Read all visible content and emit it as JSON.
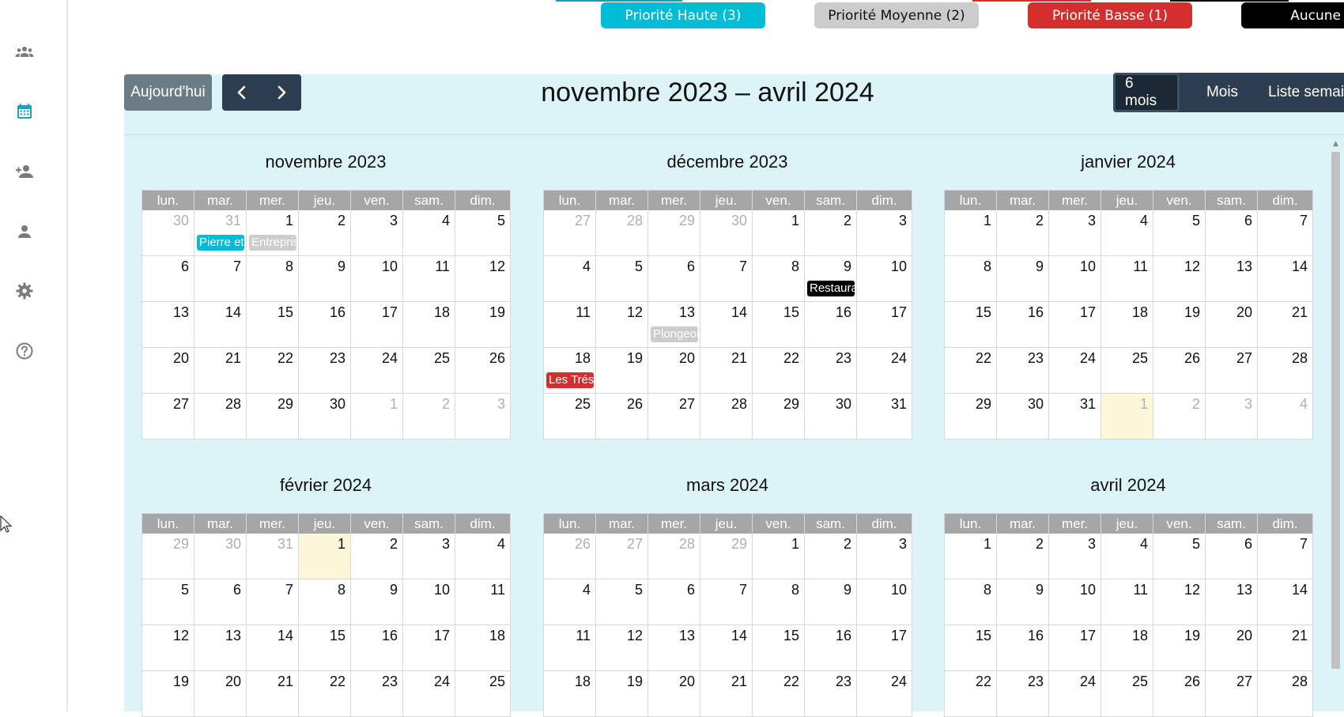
{
  "sidebar": {
    "items": [
      {
        "icon": "team-icon",
        "active": false
      },
      {
        "icon": "calendar-icon",
        "active": true
      },
      {
        "icon": "add-user-icon",
        "active": false
      },
      {
        "icon": "user-icon",
        "active": false
      },
      {
        "icon": "gear-icon",
        "active": false
      },
      {
        "icon": "help-icon",
        "active": false
      }
    ],
    "accent_color": "#1aa3b8",
    "icon_color": "#7a7a7a"
  },
  "priorities": [
    {
      "label": "Priorité Haute (3)",
      "bg": "#00bcd4",
      "fg": "#ffffff"
    },
    {
      "label": "Priorité Moyenne (2)",
      "bg": "#cccccc",
      "fg": "#111111"
    },
    {
      "label": "Priorité Basse (1)",
      "bg": "#d32f2f",
      "fg": "#ffffff"
    },
    {
      "label": "Aucune",
      "bg": "#000000",
      "fg": "#ffffff"
    }
  ],
  "toolbar": {
    "today_label": "Aujourd'hui",
    "prev_icon": "chevron-left-icon",
    "next_icon": "chevron-right-icon",
    "range_title": "novembre 2023 – avril 2024",
    "views": [
      {
        "label": "6 mois",
        "active": true
      },
      {
        "label": "Mois",
        "active": false
      },
      {
        "label": "Liste semaine",
        "active": false
      }
    ]
  },
  "weekdays": [
    "lun.",
    "mar.",
    "mer.",
    "jeu.",
    "ven.",
    "sam.",
    "dim."
  ],
  "months": [
    {
      "title": "novembre 2023",
      "weeks": [
        [
          {
            "n": "30",
            "o": true
          },
          {
            "n": "31",
            "o": true
          },
          {
            "n": "1"
          },
          {
            "n": "2"
          },
          {
            "n": "3"
          },
          {
            "n": "4"
          },
          {
            "n": "5"
          }
        ],
        [
          {
            "n": "6"
          },
          {
            "n": "7"
          },
          {
            "n": "8"
          },
          {
            "n": "9"
          },
          {
            "n": "10"
          },
          {
            "n": "11"
          },
          {
            "n": "12"
          }
        ],
        [
          {
            "n": "13"
          },
          {
            "n": "14"
          },
          {
            "n": "15"
          },
          {
            "n": "16"
          },
          {
            "n": "17"
          },
          {
            "n": "18"
          },
          {
            "n": "19"
          }
        ],
        [
          {
            "n": "20"
          },
          {
            "n": "21"
          },
          {
            "n": "22"
          },
          {
            "n": "23"
          },
          {
            "n": "24"
          },
          {
            "n": "25"
          },
          {
            "n": "26"
          }
        ],
        [
          {
            "n": "27"
          },
          {
            "n": "28"
          },
          {
            "n": "29"
          },
          {
            "n": "30"
          },
          {
            "n": "1",
            "o": true
          },
          {
            "n": "2",
            "o": true
          },
          {
            "n": "3",
            "o": true
          }
        ]
      ],
      "events": [
        {
          "week": 0,
          "day": 1,
          "label": "Pierre et",
          "bg": "#00bcd4",
          "fg": "#ffffff"
        },
        {
          "week": 0,
          "day": 2,
          "label": "Entrepris",
          "bg": "#cccccc",
          "fg": "#ffffff"
        }
      ]
    },
    {
      "title": "décembre 2023",
      "weeks": [
        [
          {
            "n": "27",
            "o": true
          },
          {
            "n": "28",
            "o": true
          },
          {
            "n": "29",
            "o": true
          },
          {
            "n": "30",
            "o": true
          },
          {
            "n": "1"
          },
          {
            "n": "2"
          },
          {
            "n": "3"
          }
        ],
        [
          {
            "n": "4"
          },
          {
            "n": "5"
          },
          {
            "n": "6"
          },
          {
            "n": "7"
          },
          {
            "n": "8"
          },
          {
            "n": "9"
          },
          {
            "n": "10"
          }
        ],
        [
          {
            "n": "11"
          },
          {
            "n": "12"
          },
          {
            "n": "13"
          },
          {
            "n": "14"
          },
          {
            "n": "15"
          },
          {
            "n": "16"
          },
          {
            "n": "17"
          }
        ],
        [
          {
            "n": "18"
          },
          {
            "n": "19"
          },
          {
            "n": "20"
          },
          {
            "n": "21"
          },
          {
            "n": "22"
          },
          {
            "n": "23"
          },
          {
            "n": "24"
          }
        ],
        [
          {
            "n": "25"
          },
          {
            "n": "26"
          },
          {
            "n": "27"
          },
          {
            "n": "28"
          },
          {
            "n": "29"
          },
          {
            "n": "30"
          },
          {
            "n": "31"
          }
        ]
      ],
      "events": [
        {
          "week": 1,
          "day": 5,
          "label": "Restaura",
          "bg": "#000000",
          "fg": "#ffffff"
        },
        {
          "week": 2,
          "day": 2,
          "label": "Plongeoi",
          "bg": "#cccccc",
          "fg": "#ffffff"
        },
        {
          "week": 3,
          "day": 0,
          "label": "Les Trés",
          "bg": "#d32f2f",
          "fg": "#ffffff"
        }
      ]
    },
    {
      "title": "janvier 2024",
      "weeks": [
        [
          {
            "n": "1"
          },
          {
            "n": "2"
          },
          {
            "n": "3"
          },
          {
            "n": "4"
          },
          {
            "n": "5"
          },
          {
            "n": "6"
          },
          {
            "n": "7"
          }
        ],
        [
          {
            "n": "8"
          },
          {
            "n": "9"
          },
          {
            "n": "10"
          },
          {
            "n": "11"
          },
          {
            "n": "12"
          },
          {
            "n": "13"
          },
          {
            "n": "14"
          }
        ],
        [
          {
            "n": "15"
          },
          {
            "n": "16"
          },
          {
            "n": "17"
          },
          {
            "n": "18"
          },
          {
            "n": "19"
          },
          {
            "n": "20"
          },
          {
            "n": "21"
          }
        ],
        [
          {
            "n": "22"
          },
          {
            "n": "23"
          },
          {
            "n": "24"
          },
          {
            "n": "25"
          },
          {
            "n": "26"
          },
          {
            "n": "27"
          },
          {
            "n": "28"
          }
        ],
        [
          {
            "n": "29"
          },
          {
            "n": "30"
          },
          {
            "n": "31"
          },
          {
            "n": "1",
            "o": true,
            "t": true
          },
          {
            "n": "2",
            "o": true
          },
          {
            "n": "3",
            "o": true
          },
          {
            "n": "4",
            "o": true
          }
        ]
      ],
      "events": []
    },
    {
      "title": "février 2024",
      "weeks": [
        [
          {
            "n": "29",
            "o": true
          },
          {
            "n": "30",
            "o": true
          },
          {
            "n": "31",
            "o": true
          },
          {
            "n": "1",
            "t": true
          },
          {
            "n": "2"
          },
          {
            "n": "3"
          },
          {
            "n": "4"
          }
        ],
        [
          {
            "n": "5"
          },
          {
            "n": "6"
          },
          {
            "n": "7"
          },
          {
            "n": "8"
          },
          {
            "n": "9"
          },
          {
            "n": "10"
          },
          {
            "n": "11"
          }
        ],
        [
          {
            "n": "12"
          },
          {
            "n": "13"
          },
          {
            "n": "14"
          },
          {
            "n": "15"
          },
          {
            "n": "16"
          },
          {
            "n": "17"
          },
          {
            "n": "18"
          }
        ],
        [
          {
            "n": "19"
          },
          {
            "n": "20"
          },
          {
            "n": "21"
          },
          {
            "n": "22"
          },
          {
            "n": "23"
          },
          {
            "n": "24"
          },
          {
            "n": "25"
          }
        ]
      ],
      "events": []
    },
    {
      "title": "mars 2024",
      "weeks": [
        [
          {
            "n": "26",
            "o": true
          },
          {
            "n": "27",
            "o": true
          },
          {
            "n": "28",
            "o": true
          },
          {
            "n": "29",
            "o": true
          },
          {
            "n": "1"
          },
          {
            "n": "2"
          },
          {
            "n": "3"
          }
        ],
        [
          {
            "n": "4"
          },
          {
            "n": "5"
          },
          {
            "n": "6"
          },
          {
            "n": "7"
          },
          {
            "n": "8"
          },
          {
            "n": "9"
          },
          {
            "n": "10"
          }
        ],
        [
          {
            "n": "11"
          },
          {
            "n": "12"
          },
          {
            "n": "13"
          },
          {
            "n": "14"
          },
          {
            "n": "15"
          },
          {
            "n": "16"
          },
          {
            "n": "17"
          }
        ],
        [
          {
            "n": "18"
          },
          {
            "n": "19"
          },
          {
            "n": "20"
          },
          {
            "n": "21"
          },
          {
            "n": "22"
          },
          {
            "n": "23"
          },
          {
            "n": "24"
          }
        ]
      ],
      "events": []
    },
    {
      "title": "avril 2024",
      "weeks": [
        [
          {
            "n": "1"
          },
          {
            "n": "2"
          },
          {
            "n": "3"
          },
          {
            "n": "4"
          },
          {
            "n": "5"
          },
          {
            "n": "6"
          },
          {
            "n": "7"
          }
        ],
        [
          {
            "n": "8"
          },
          {
            "n": "9"
          },
          {
            "n": "10"
          },
          {
            "n": "11"
          },
          {
            "n": "12"
          },
          {
            "n": "13"
          },
          {
            "n": "14"
          }
        ],
        [
          {
            "n": "15"
          },
          {
            "n": "16"
          },
          {
            "n": "17"
          },
          {
            "n": "18"
          },
          {
            "n": "19"
          },
          {
            "n": "20"
          },
          {
            "n": "21"
          }
        ],
        [
          {
            "n": "22"
          },
          {
            "n": "23"
          },
          {
            "n": "24"
          },
          {
            "n": "25"
          },
          {
            "n": "26"
          },
          {
            "n": "27"
          },
          {
            "n": "28"
          }
        ]
      ],
      "events": []
    }
  ],
  "colors": {
    "panel_bg": "#dcf4f8",
    "today_bg": "#fdf7da",
    "header_bg": "#a6a6a6",
    "dark_btn": "#2c3e50",
    "today_btn": "#6c7c87"
  }
}
